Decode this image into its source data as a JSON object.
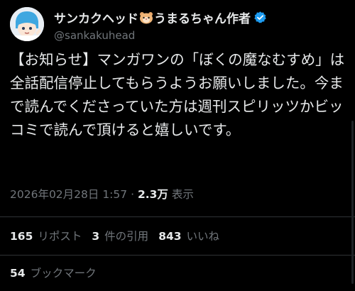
{
  "author": {
    "display_name_part1": "サンカクヘッド",
    "display_name_part2": "うまるちゃん作者",
    "handle": "@sankakuhead",
    "emoji": "hamster-face-icon",
    "verified_color": "#1d9bf0"
  },
  "tweet": {
    "text": "【お知らせ】マンガワンの「ぼくの魔なむすめ」は全話配信停止してもらうようお願いしました。今まで読んでくださっていた方は週刊スピリッツかビッコミで読んで頂けると嬉しいです。"
  },
  "meta": {
    "timestamp": "2026年02月28日 1:57",
    "separator": "·",
    "views_count": "2.3万",
    "views_label": "表示"
  },
  "stats": {
    "reposts_count": "165",
    "reposts_label": "リポスト",
    "quotes_count": "3",
    "quotes_label": "件の引用",
    "likes_count": "843",
    "likes_label": "いいね"
  },
  "bookmarks": {
    "count": "54",
    "label": "ブックマーク"
  },
  "colors": {
    "background": "#000000",
    "text": "#e7e9ea",
    "muted": "#71767b",
    "divider": "#2f3336"
  }
}
